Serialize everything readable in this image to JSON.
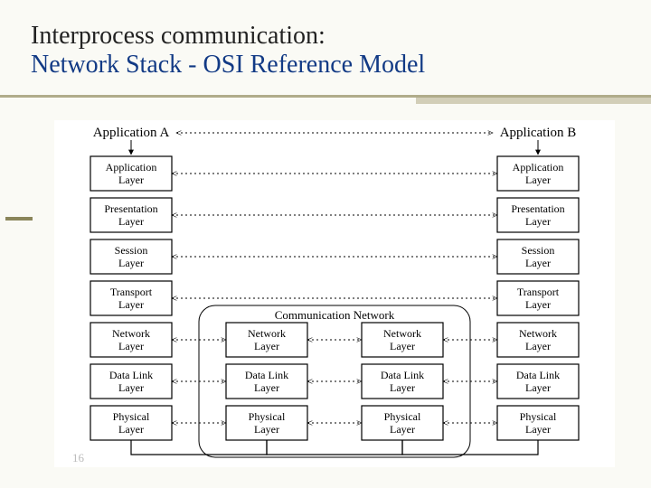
{
  "title": {
    "line1": "Interprocess communication:",
    "line2": "Network Stack - OSI Reference Model"
  },
  "diagram": {
    "endpoints": {
      "a": "Application A",
      "b": "Application B"
    },
    "commNetworkLabel": "Communication Network",
    "layers": [
      {
        "name": [
          "Application",
          "Layer"
        ]
      },
      {
        "name": [
          "Presentation",
          "Layer"
        ]
      },
      {
        "name": [
          "Session",
          "Layer"
        ]
      },
      {
        "name": [
          "Transport",
          "Layer"
        ]
      },
      {
        "name": [
          "Network",
          "Layer"
        ],
        "router": true
      },
      {
        "name": [
          "Data Link",
          "Layer"
        ],
        "router": true
      },
      {
        "name": [
          "Physical",
          "Layer"
        ],
        "router": true
      }
    ]
  },
  "footer": {
    "page": "16"
  }
}
